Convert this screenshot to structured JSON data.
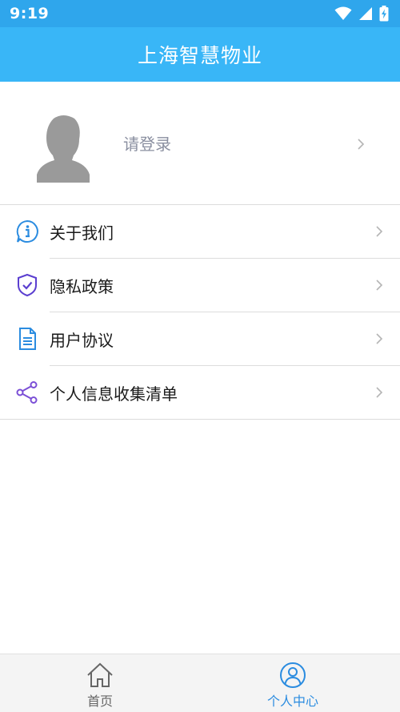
{
  "status_bar": {
    "time": "9:19",
    "icons": [
      "wifi-icon",
      "signal-icon",
      "battery-charging-icon"
    ]
  },
  "app_bar": {
    "title": "上海智慧物业"
  },
  "profile": {
    "login_label": "请登录",
    "avatar_icon": "default-avatar-icon"
  },
  "menu": {
    "items": [
      {
        "label": "关于我们",
        "icon": "info-icon"
      },
      {
        "label": "隐私政策",
        "icon": "shield-check-icon"
      },
      {
        "label": "用户协议",
        "icon": "document-icon"
      },
      {
        "label": "个人信息收集清单",
        "icon": "share-icon"
      }
    ]
  },
  "bottom_nav": {
    "items": [
      {
        "label": "首页",
        "icon": "home-icon",
        "active": false
      },
      {
        "label": "个人中心",
        "icon": "user-icon",
        "active": true
      }
    ]
  },
  "colors": {
    "status_bar": "#2FA6EC",
    "app_bar": "#39B6F7",
    "active_tab": "#2B8CE0",
    "inactive_tab": "#666666",
    "info_icon": "#2B8CE0",
    "shield_icon": "#5B3FD0",
    "document_icon": "#2B8CE0",
    "share_icon": "#7B4FD6"
  }
}
